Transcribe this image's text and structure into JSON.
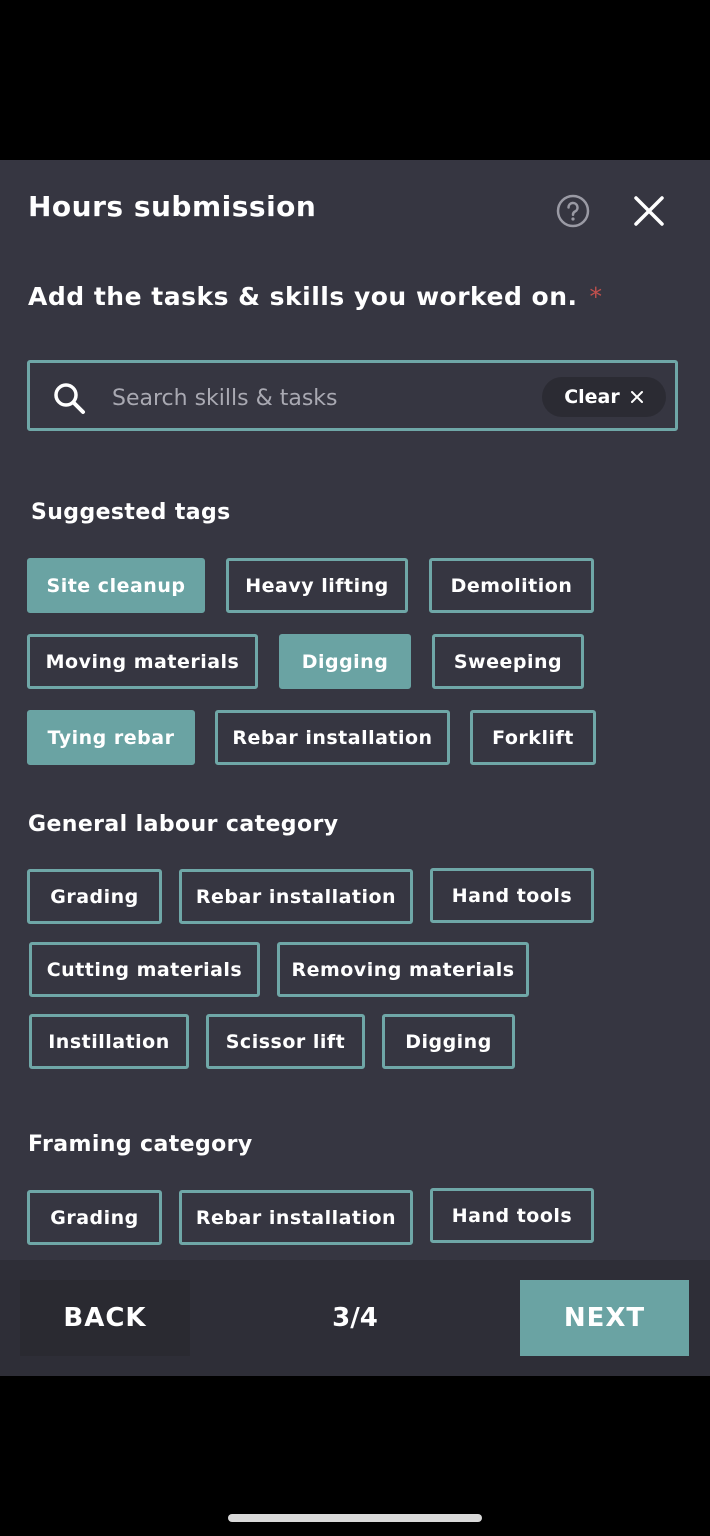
{
  "header": {
    "title": "Hours submission"
  },
  "prompt": {
    "text": "Add the tasks & skills you worked on.",
    "required_mark": "*"
  },
  "search": {
    "placeholder": "Search skills & tasks",
    "value": "",
    "clear_label": "Clear"
  },
  "suggested": {
    "title": "Suggested tags",
    "tags": [
      {
        "label": "Site cleanup",
        "selected": true
      },
      {
        "label": "Heavy lifting",
        "selected": false
      },
      {
        "label": "Demolition",
        "selected": false
      },
      {
        "label": "Moving materials",
        "selected": false
      },
      {
        "label": "Digging",
        "selected": true
      },
      {
        "label": "Sweeping",
        "selected": false
      },
      {
        "label": "Tying rebar",
        "selected": true
      },
      {
        "label": "Rebar installation",
        "selected": false
      },
      {
        "label": "Forklift",
        "selected": false
      }
    ]
  },
  "general": {
    "title": "General labour category",
    "tags": [
      {
        "label": "Grading",
        "selected": false
      },
      {
        "label": "Rebar installation",
        "selected": false
      },
      {
        "label": "Hand tools",
        "selected": false
      },
      {
        "label": "Cutting materials",
        "selected": false
      },
      {
        "label": "Removing materials",
        "selected": false
      },
      {
        "label": "Instillation",
        "selected": false
      },
      {
        "label": "Scissor lift",
        "selected": false
      },
      {
        "label": "Digging",
        "selected": false
      }
    ]
  },
  "framing": {
    "title": "Framing category",
    "tags": [
      {
        "label": "Grading",
        "selected": false
      },
      {
        "label": "Rebar installation",
        "selected": false
      },
      {
        "label": "Hand tools",
        "selected": false
      }
    ]
  },
  "footer": {
    "back_label": "BACK",
    "step": "3/4",
    "next_label": "NEXT"
  },
  "colors": {
    "sheet_bg": "#363641",
    "accent": "#6aa3a3",
    "required": "#c0504d",
    "footer_bg": "#2e2e37"
  },
  "icons": {
    "help": "question-circle-icon",
    "close": "close-icon",
    "search": "search-icon",
    "clear": "x-small-icon"
  }
}
